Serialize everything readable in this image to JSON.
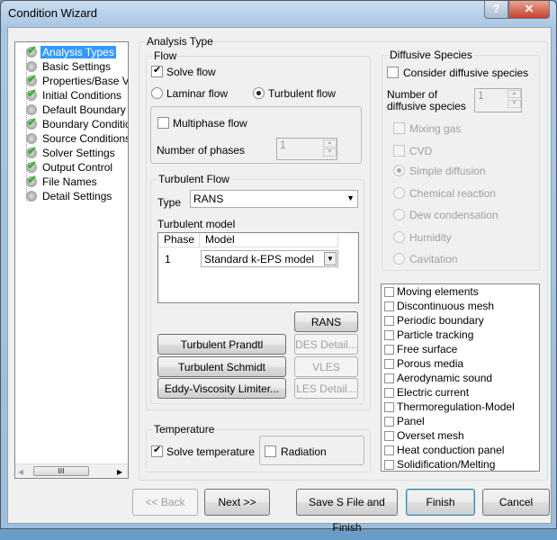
{
  "window": {
    "title": "Condition Wizard",
    "help": "?",
    "close": "✕"
  },
  "tree": {
    "items": [
      {
        "label": "Analysis Types",
        "done": true,
        "selected": true
      },
      {
        "label": "Basic Settings",
        "done": false
      },
      {
        "label": "Properties/Base V",
        "done": true
      },
      {
        "label": "Initial Conditions",
        "done": true
      },
      {
        "label": "Default Boundary",
        "done": false
      },
      {
        "label": "Boundary Conditic",
        "done": true
      },
      {
        "label": "Source Conditions",
        "done": false
      },
      {
        "label": "Solver Settings",
        "done": true
      },
      {
        "label": "Output Control",
        "done": true
      },
      {
        "label": "File Names",
        "done": true
      },
      {
        "label": "Detail Settings",
        "done": false
      }
    ],
    "scroll_left": "◂",
    "scroll_right": "▸",
    "scroll_grip": "III"
  },
  "analysis_type": {
    "legend": "Analysis Type",
    "flow": {
      "legend": "Flow",
      "solve_flow": "Solve flow",
      "laminar": "Laminar flow",
      "turbulent": "Turbulent flow",
      "multiphase": "Multiphase flow",
      "num_phases_label": "Number of phases",
      "num_phases": "1"
    },
    "turbulent_flow": {
      "legend": "Turbulent Flow",
      "type_label": "Type",
      "type_value": "RANS",
      "model_label": "Turbulent model",
      "columns": [
        "Phase",
        "Model"
      ],
      "rows": [
        {
          "phase": "1",
          "model": "Standard k-EPS model"
        }
      ],
      "buttons": {
        "rans": "RANS Detail...",
        "des": "DES Detail...",
        "vles": "VLES Detail...",
        "les": "LES Detail...",
        "prandtl": "Turbulent Prandtl Number...",
        "schmidt": "Turbulent Schmidt Number...",
        "eddy": "Eddy-Viscosity Limiter..."
      }
    },
    "temperature": {
      "legend": "Temperature",
      "solve": "Solve temperature",
      "radiation": "Radiation"
    },
    "diffusive": {
      "legend": "Diffusive Species",
      "consider": "Consider diffusive species",
      "num_label_1": "Number of",
      "num_label_2": "diffusive species",
      "num": "1",
      "mixing_gas": "Mixing gas",
      "cvd": "CVD",
      "options": [
        "Simple diffusion",
        "Chemical reaction",
        "Dew condensation",
        "Humidity",
        "Cavitation"
      ]
    },
    "features": [
      "Moving elements",
      "Discontinuous mesh",
      "Periodic boundary",
      "Particle tracking",
      "Free surface",
      "Porous media",
      "Aerodynamic sound",
      "Electric current",
      "Thermoregulation-Model",
      "Panel",
      "Overset mesh",
      "Heat conduction panel",
      "Solidification/Melting"
    ]
  },
  "footer": {
    "back": "<< Back",
    "next": "Next >>",
    "save": "Save S File and Finish",
    "finish": "Finish",
    "cancel": "Cancel"
  }
}
